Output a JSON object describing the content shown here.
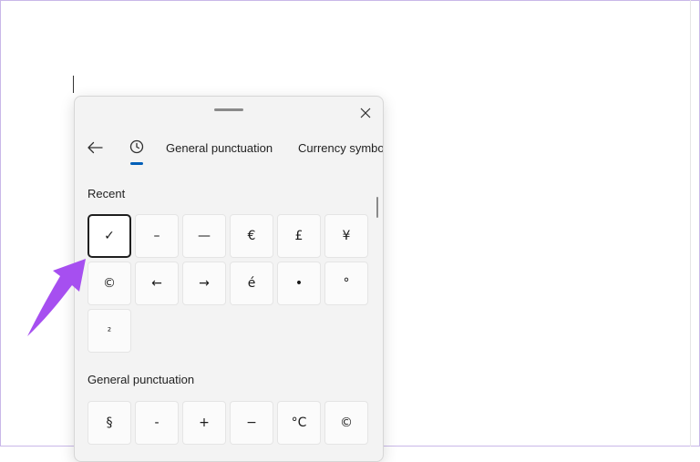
{
  "emoji_panel": {
    "tabs": {
      "general_punctuation": "General punctuation",
      "currency_symbols": "Currency symbo"
    },
    "sections": {
      "recent": {
        "heading": "Recent",
        "symbols": [
          "✓",
          "–",
          "—",
          "€",
          "£",
          "¥",
          "©",
          "←",
          "→",
          "é",
          "•",
          "°",
          "²"
        ]
      },
      "general": {
        "heading": "General punctuation",
        "symbols": [
          "§",
          "-",
          "+",
          "−",
          "°C",
          "©"
        ]
      }
    }
  },
  "icons": {
    "close": "close-icon",
    "back": "arrow-left-icon",
    "recent": "clock-icon",
    "drag": "drag-handle-icon",
    "annotation": "annotation-arrow"
  },
  "colors": {
    "accent": "#005fb8",
    "annotation_arrow": "#a64ff0",
    "panel_background": "#f3f3f3"
  }
}
